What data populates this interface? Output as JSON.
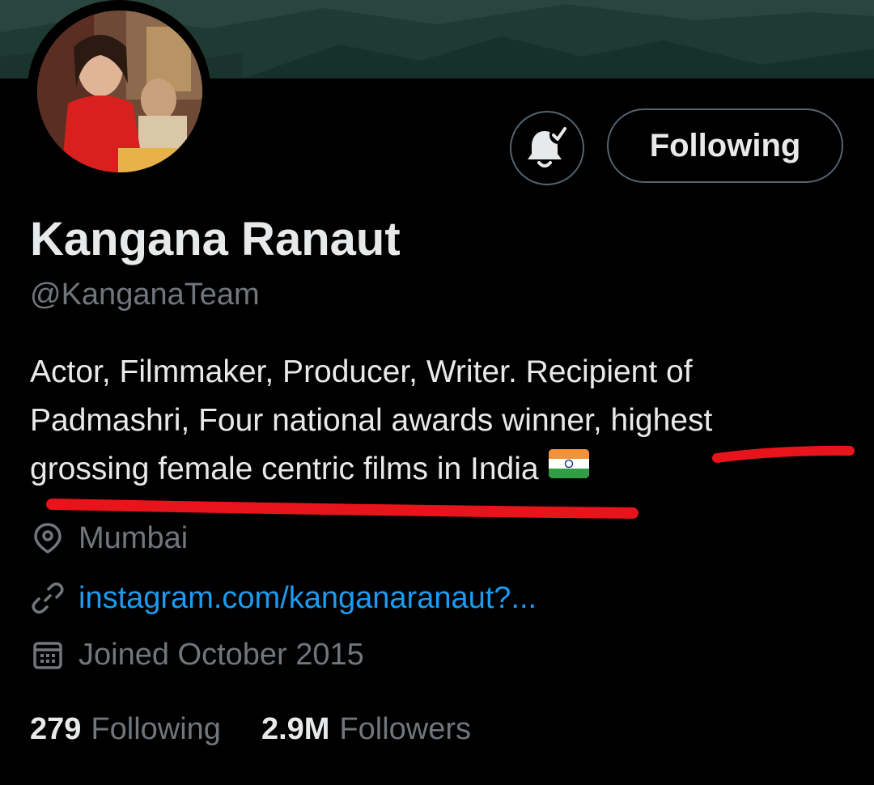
{
  "profile": {
    "name": "Kangana Ranaut",
    "handle": "@KanganaTeam",
    "follow_label": "Following",
    "bio_lines": [
      "Actor, Filmmaker, Producer, Writer. Recipient of",
      "Padmashri, Four national awards winner, highest",
      "grossing female centric films in India"
    ],
    "flag_icon": "india-flag-icon",
    "location": "Mumbai",
    "website": "instagram.com/kanganaranaut?...",
    "joined": "Joined October 2015",
    "following_count": "279",
    "following_label": "Following",
    "followers_count": "2.9M",
    "followers_label": "Followers"
  },
  "icons": {
    "bell": "bell-check-icon",
    "location": "location-pin-icon",
    "link": "link-icon",
    "calendar": "calendar-icon"
  },
  "colors": {
    "background": "#000000",
    "text_primary": "#e7e9ea",
    "text_secondary": "#71767b",
    "link": "#1d9bf0",
    "button_border": "#536471",
    "annotation": "#e8141c"
  }
}
